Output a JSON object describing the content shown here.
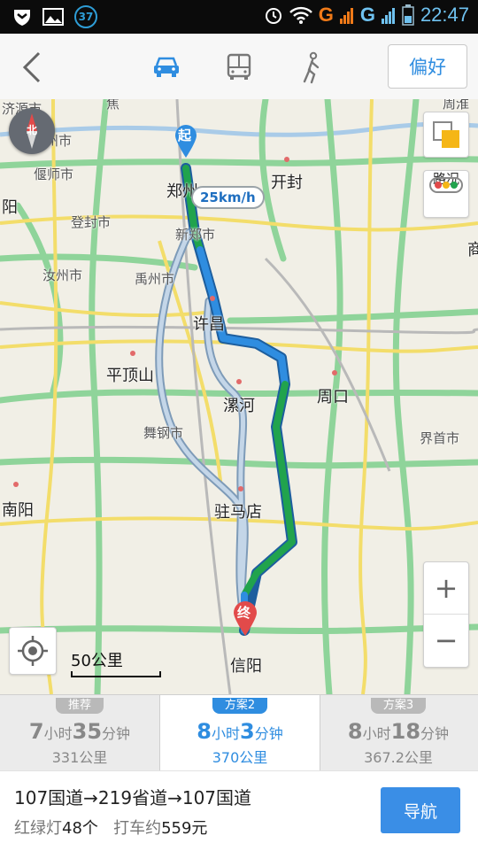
{
  "status": {
    "badge": "37",
    "network_1": "G",
    "network_2": "G",
    "time": "22:47"
  },
  "topbar": {
    "modes": [
      {
        "name": "car",
        "icon": "car-icon",
        "selected": true
      },
      {
        "name": "bus",
        "icon": "bus-icon",
        "selected": false
      },
      {
        "name": "walk",
        "icon": "walk-icon",
        "selected": false
      }
    ],
    "preference_label": "偏好",
    "accent": "#2f8de0"
  },
  "map": {
    "compass_label": "北",
    "traffic_label": "路况",
    "start_marker": "起",
    "end_marker": "终",
    "speed_label": "25km/h",
    "scale_label": "50公里",
    "cities": [
      "郑州",
      "开封",
      "许昌",
      "平顶山",
      "漯河",
      "周口",
      "驻马店",
      "信阳",
      "南阳",
      "阳",
      "商"
    ],
    "towns": [
      "济源市",
      "孟州市",
      "偃师市",
      "登封市",
      "新郑市",
      "汝州市",
      "禹州市",
      "舞钢市",
      "界首市",
      "焦",
      "周淮"
    ],
    "zoom_in": "+",
    "zoom_out": "−"
  },
  "route_tabs": [
    {
      "tag": "推荐",
      "hours": "7",
      "hour_unit": "小时",
      "minutes": "35",
      "minute_unit": "分钟",
      "distance": "331公里",
      "active": false
    },
    {
      "tag": "方案2",
      "hours": "8",
      "hour_unit": "小时",
      "minutes": "3",
      "minute_unit": "分钟",
      "distance": "370公里",
      "active": true
    },
    {
      "tag": "方案3",
      "hours": "8",
      "hour_unit": "小时",
      "minutes": "18",
      "minute_unit": "分钟",
      "distance": "367.2公里",
      "active": false
    }
  ],
  "summary": {
    "route": "107国道→219省道→107国道",
    "lights_label": "红绿灯",
    "lights_count": "48个",
    "taxi_label": "打车约",
    "taxi_price": "559元"
  },
  "navigate_label": "导航",
  "colors": {
    "route_blue": "#2f8de0",
    "route_green": "#21a34d",
    "road_green": "#8fd49a",
    "road_yellow": "#f3dd6a",
    "alt_route": "#a9c0d8"
  }
}
